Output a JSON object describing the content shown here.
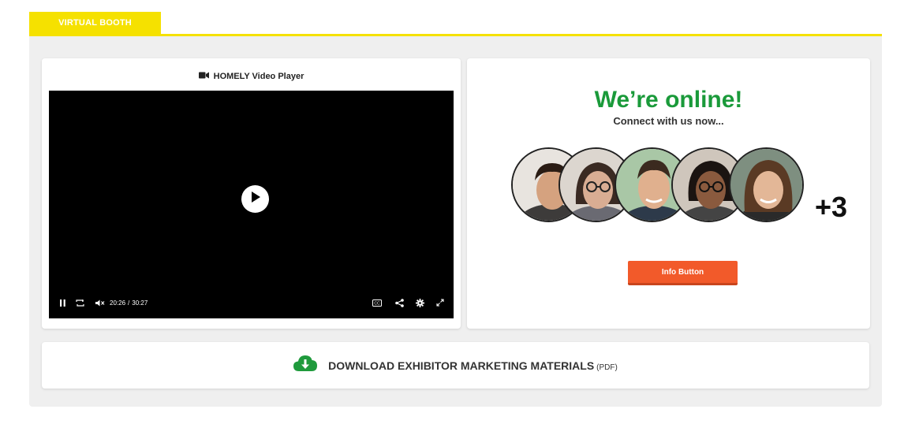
{
  "tab": {
    "label": "VIRTUAL BOOTH"
  },
  "video": {
    "title": "HOMELY Video Player",
    "current_time": "20:26",
    "separator": "/",
    "duration": "30:27"
  },
  "online": {
    "title": "We’re online!",
    "subtitle": "Connect with us now...",
    "more_count": "+3",
    "button_label": "Info Button"
  },
  "download": {
    "label": "DOWNLOAD EXHIBITOR MARKETING MATERIALS",
    "suffix": "(PDF)"
  },
  "colors": {
    "accent_yellow": "#f5e100",
    "online_green": "#1a9a3a",
    "button_orange": "#f25a2a",
    "cloud_green": "#1f9a3c",
    "panel_gray": "#efefef"
  },
  "icons": [
    "video-camera-icon",
    "play-icon",
    "pause-icon",
    "loop-icon",
    "mute-icon",
    "closed-caption-icon",
    "share-icon",
    "settings-icon",
    "fullscreen-icon",
    "cloud-download-icon"
  ]
}
